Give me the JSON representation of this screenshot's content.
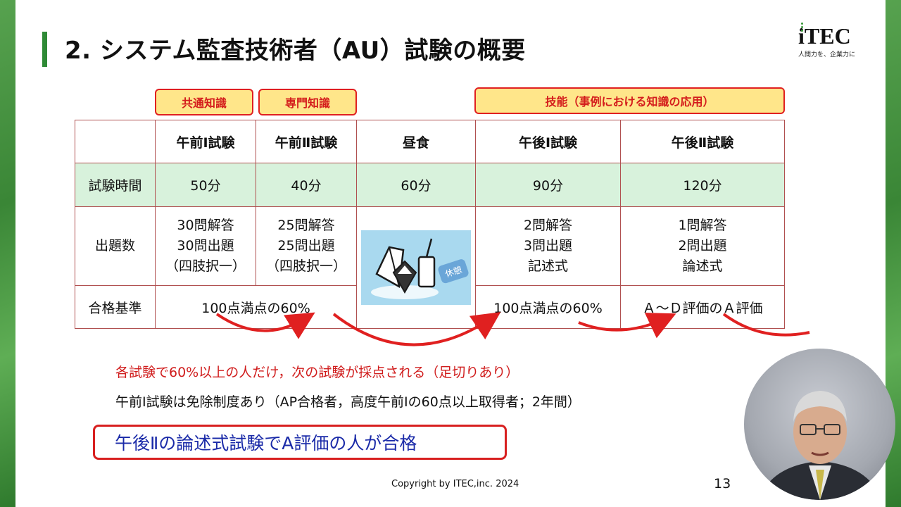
{
  "slide": {
    "title": "2. システム監査技術者（AU）試験の概要",
    "logo": {
      "text": "iTEC",
      "tagline": "人間力を、企業力に"
    }
  },
  "tags": {
    "common": "共通知識",
    "specialty": "専門知識",
    "skill": "技能（事例における知識の応用）"
  },
  "table": {
    "headers": [
      "",
      "午前Ⅰ試験",
      "午前Ⅱ試験",
      "昼食",
      "午後Ⅰ試験",
      "午後Ⅱ試験"
    ],
    "rows": {
      "time": {
        "label": "試験時間",
        "values": [
          "50分",
          "40分",
          "60分",
          "90分",
          "120分"
        ]
      },
      "questions": {
        "label": "出題数",
        "am1": [
          "30問解答",
          "30問出題",
          "（四肢択一）"
        ],
        "am2": [
          "25問解答",
          "25問出題",
          "（四肢択一）"
        ],
        "pm1": [
          "2問解答",
          "3問出題",
          "記述式"
        ],
        "pm2": [
          "1問解答",
          "2問出題",
          "論述式"
        ]
      },
      "pass": {
        "label": "合格基準",
        "am": "100点満点の60%",
        "pm1": "100点満点の60%",
        "pm2": "Ａ～Ｄ評価のＡ評価"
      }
    },
    "lunch_image_text": "休憩"
  },
  "notes": {
    "red": "各試験で60%以上の人だけ，次の試験が採点される（足切りあり）",
    "black": "午前Ⅰ試験は免除制度あり（AP合格者，高度午前Ⅰの60点以上取得者；2年間）",
    "pass_box": "午後Ⅱの論述式試験でA評価の人が合格"
  },
  "footer": {
    "copyright": "Copyright by ITEC,inc. 2024",
    "page": "13"
  },
  "colors": {
    "accent_green": "#2f8a36",
    "red": "#d01c1c",
    "blue": "#1a2aa8",
    "tag_fill": "#ffe68a",
    "time_row": "#d8f2dc"
  }
}
